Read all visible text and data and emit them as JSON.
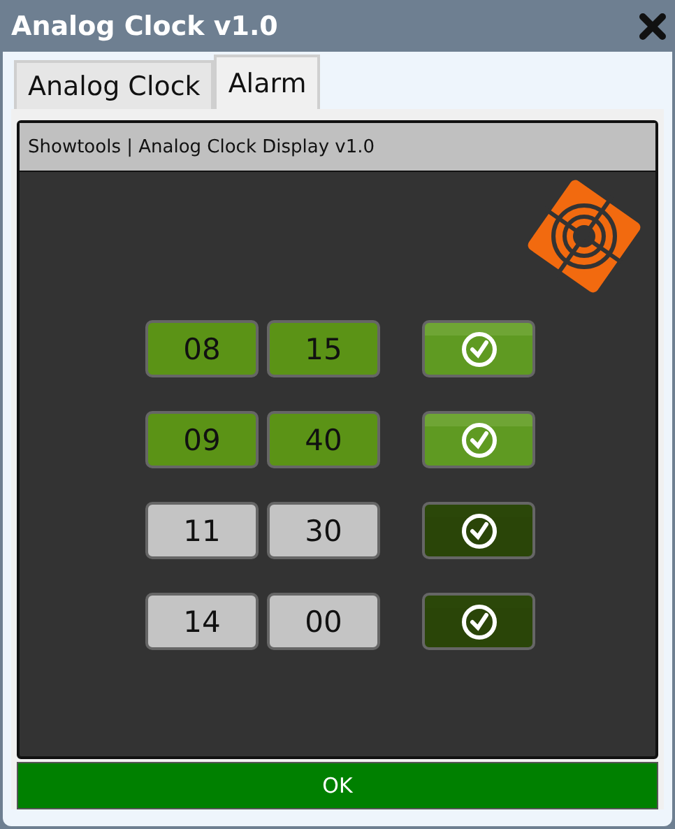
{
  "window": {
    "title": "Analog Clock v1.0"
  },
  "tabs": [
    {
      "label": "Analog Clock",
      "selected": false
    },
    {
      "label": "Alarm",
      "selected": true
    }
  ],
  "panel": {
    "title": "Showtools | Analog Clock Display v1.0"
  },
  "alarms": [
    {
      "hour": "08",
      "minute": "15",
      "on": true
    },
    {
      "hour": "09",
      "minute": "40",
      "on": true
    },
    {
      "hour": "11",
      "minute": "30",
      "on": false
    },
    {
      "hour": "14",
      "minute": "00",
      "on": false
    }
  ],
  "buttons": [
    "OK"
  ]
}
